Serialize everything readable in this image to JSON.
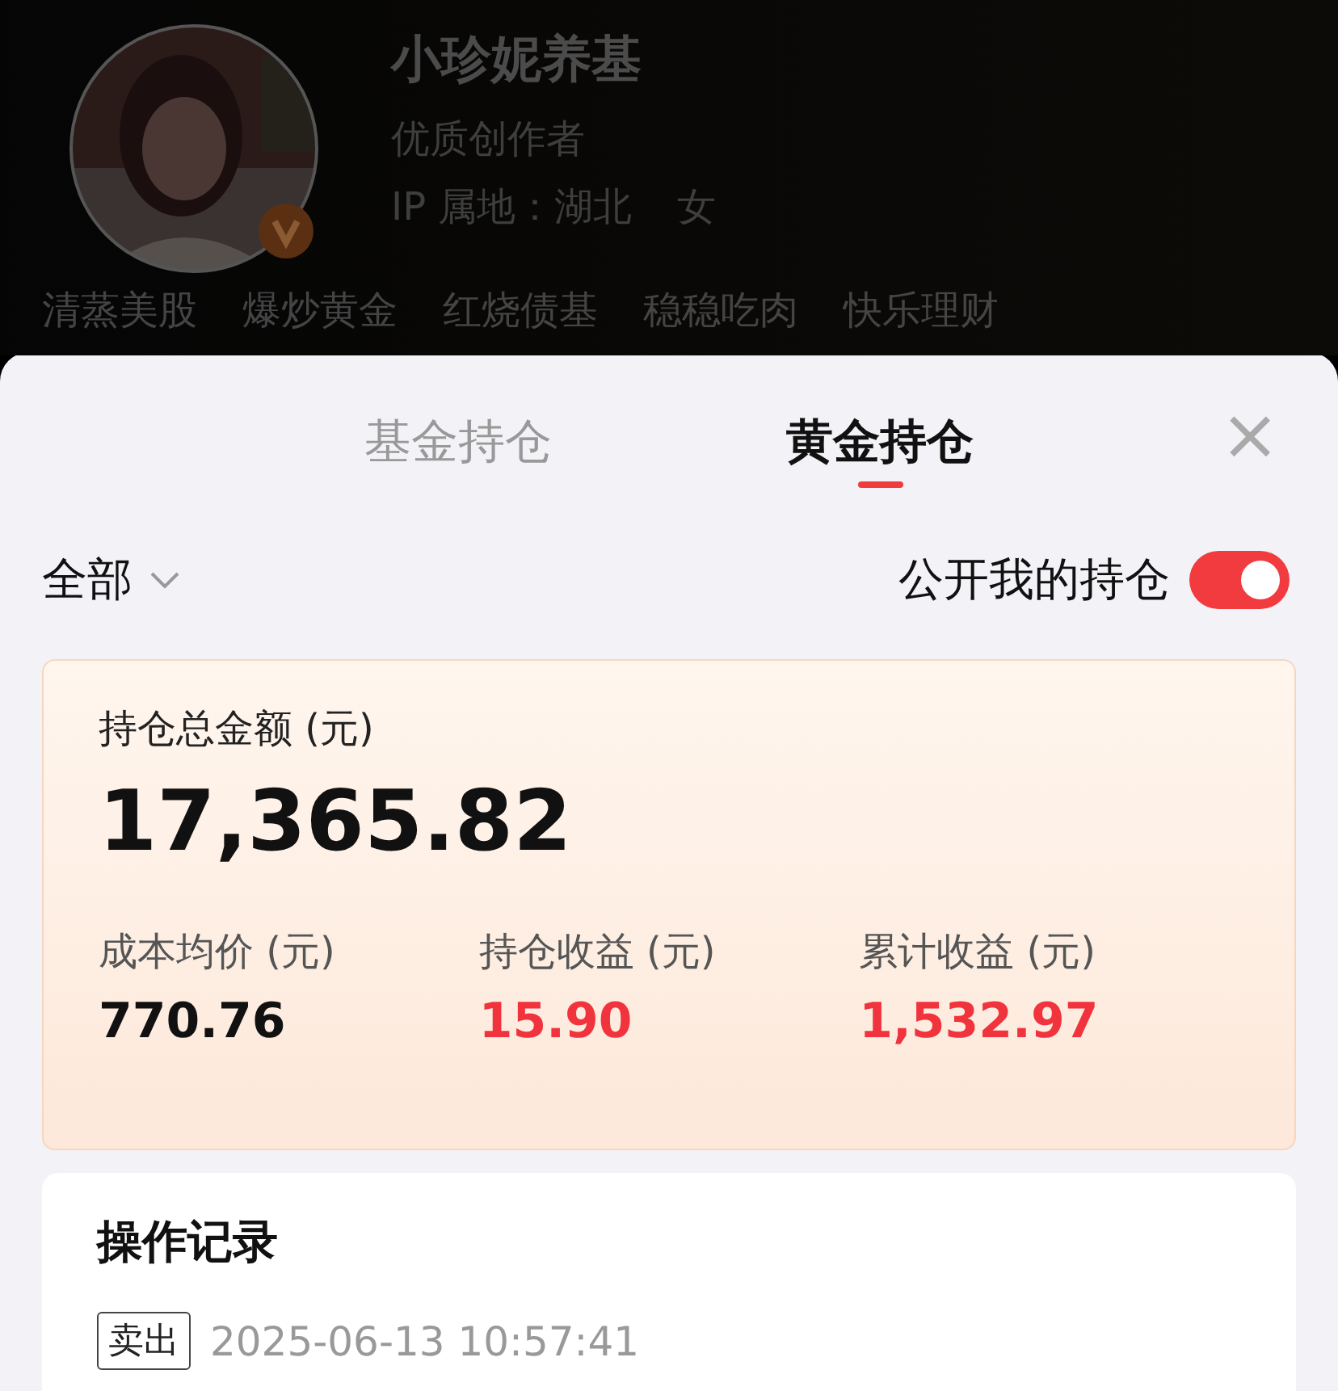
{
  "profile": {
    "name": "小珍妮养基",
    "title": "优质创作者",
    "location": "IP 属地：湖北",
    "gender": "女",
    "verified": true,
    "tags": [
      "清蒸美股",
      "爆炒黄金",
      "红烧债基",
      "稳稳吃肉",
      "快乐理财"
    ]
  },
  "tabs": [
    {
      "label": "基金持仓",
      "selected": false
    },
    {
      "label": "黄金持仓",
      "selected": true
    }
  ],
  "close": "×",
  "filter": {
    "label": "全部"
  },
  "public_toggle": {
    "label": "公开我的持仓",
    "on": true
  },
  "summary": {
    "total_label": "持仓总金额 (元)",
    "total": "17,365.82",
    "stats": [
      {
        "label": "成本均价 (元)",
        "value": "770.76",
        "positive": false
      },
      {
        "label": "持仓收益 (元)",
        "value": "15.90",
        "positive": true
      },
      {
        "label": "累计收益 (元)",
        "value": "1,532.97",
        "positive": true
      }
    ]
  },
  "records": {
    "title": "操作记录",
    "items": [
      {
        "action": "卖出",
        "time": "2025-06-13 10:57:41"
      }
    ]
  }
}
